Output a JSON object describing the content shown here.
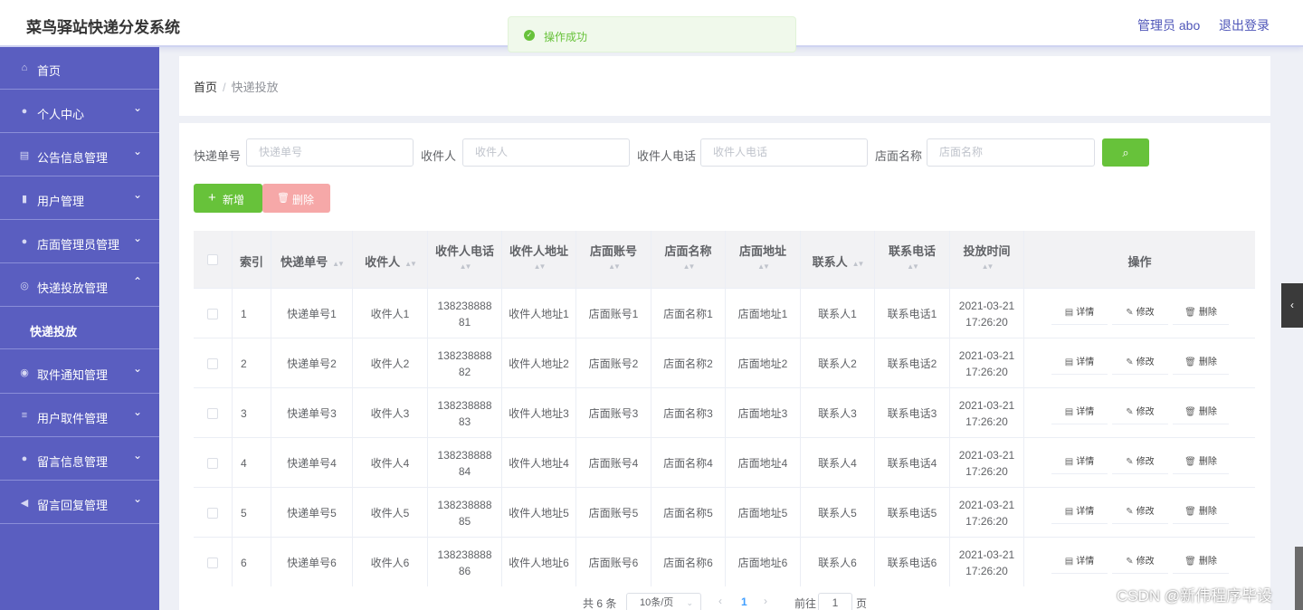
{
  "header": {
    "title": "菜鸟驿站快递分发系统",
    "admin": "管理员 abo",
    "logout": "退出登录"
  },
  "toast": {
    "message": "操作成功"
  },
  "sidebar": {
    "items": [
      {
        "icon": "home-icon",
        "label": "首页"
      },
      {
        "icon": "user-icon",
        "label": "个人中心"
      },
      {
        "icon": "notice-icon",
        "label": "公告信息管理"
      },
      {
        "icon": "mic-icon",
        "label": "用户管理"
      },
      {
        "icon": "user-icon",
        "label": "店面管理员管理"
      },
      {
        "icon": "compass-icon",
        "label": "快递投放管理"
      },
      {
        "icon": "target-icon",
        "label": "取件通知管理"
      },
      {
        "icon": "list-icon",
        "label": "用户取件管理"
      },
      {
        "icon": "location-icon",
        "label": "留言信息管理"
      },
      {
        "icon": "send-icon",
        "label": "留言回复管理"
      }
    ],
    "sub_item": "快递投放"
  },
  "breadcrumb": {
    "home": "首页",
    "separator": "/",
    "current": "快递投放"
  },
  "filters": {
    "tracking_label": "快递单号",
    "tracking_placeholder": "快递单号",
    "recipient_label": "收件人",
    "recipient_placeholder": "收件人",
    "phone_label": "收件人电话",
    "phone_placeholder": "收件人电话",
    "store_label": "店面名称",
    "store_placeholder": "店面名称"
  },
  "actions": {
    "add": "新增",
    "delete": "删除"
  },
  "table": {
    "columns": [
      "索引",
      "快递单号",
      "收件人",
      "收件人电话",
      "收件人地址",
      "店面账号",
      "店面名称",
      "店面地址",
      "联系人",
      "联系电话",
      "投放时间",
      "操作"
    ],
    "row_actions": {
      "detail": "详情",
      "edit": "修改",
      "delete": "删除"
    },
    "rows": [
      [
        "1",
        "快递单号1",
        "收件人1",
        "13823888881",
        "收件人地址1",
        "店面账号1",
        "店面名称1",
        "店面地址1",
        "联系人1",
        "联系电话1",
        "2021-03-21 17:26:20"
      ],
      [
        "2",
        "快递单号2",
        "收件人2",
        "13823888882",
        "收件人地址2",
        "店面账号2",
        "店面名称2",
        "店面地址2",
        "联系人2",
        "联系电话2",
        "2021-03-21 17:26:20"
      ],
      [
        "3",
        "快递单号3",
        "收件人3",
        "13823888883",
        "收件人地址3",
        "店面账号3",
        "店面名称3",
        "店面地址3",
        "联系人3",
        "联系电话3",
        "2021-03-21 17:26:20"
      ],
      [
        "4",
        "快递单号4",
        "收件人4",
        "13823888884",
        "收件人地址4",
        "店面账号4",
        "店面名称4",
        "店面地址4",
        "联系人4",
        "联系电话4",
        "2021-03-21 17:26:20"
      ],
      [
        "5",
        "快递单号5",
        "收件人5",
        "13823888885",
        "收件人地址5",
        "店面账号5",
        "店面名称5",
        "店面地址5",
        "联系人5",
        "联系电话5",
        "2021-03-21 17:26:20"
      ],
      [
        "6",
        "快递单号6",
        "收件人6",
        "13823888886",
        "收件人地址6",
        "店面账号6",
        "店面名称6",
        "店面地址6",
        "联系人6",
        "联系电话6",
        "2021-03-21 17:26:20"
      ]
    ]
  },
  "pagination": {
    "total": "共 6 条",
    "page_size": "10条/页",
    "current_page": "1",
    "goto_label": "前往",
    "goto_value": "1",
    "page_suffix": "页"
  },
  "watermark": "CSDN @新伟程序毕设"
}
